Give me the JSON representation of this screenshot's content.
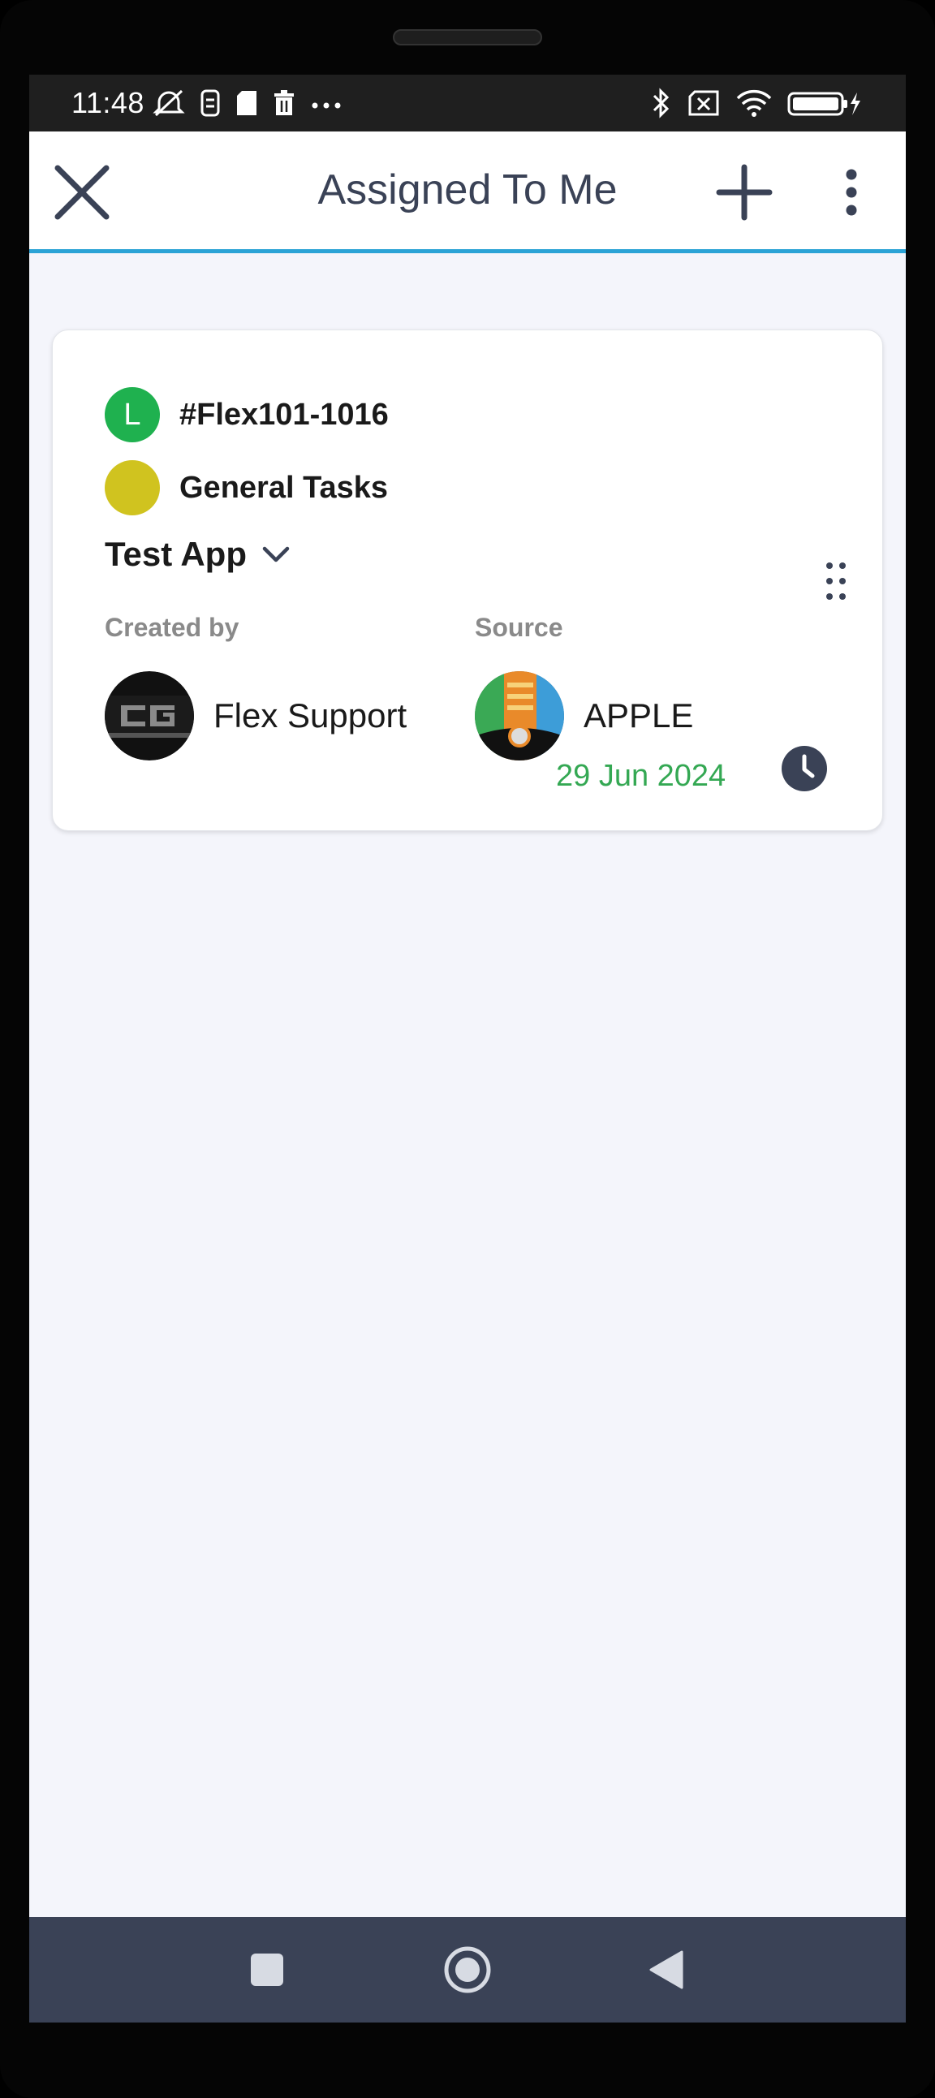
{
  "status_bar": {
    "time": "11:48",
    "left_icons": [
      "alarm-off-icon",
      "sim-icon",
      "sd-card-icon",
      "trash-icon",
      "more-dots-icon"
    ],
    "right_icons": [
      "bluetooth-icon",
      "no-sim-icon",
      "wifi-icon",
      "battery-charging-icon"
    ]
  },
  "header": {
    "title": "Assigned To Me",
    "close_icon": "close-icon",
    "add_icon": "plus-icon",
    "menu_icon": "more-vertical-icon"
  },
  "card": {
    "ticket_id": "#Flex101-1016",
    "ticket_badge_letter": "L",
    "ticket_badge_color": "#1fb14f",
    "category": "General Tasks",
    "category_color": "#d0c31f",
    "app_name": "Test App",
    "created_by_label": "Created by",
    "created_by_name": "Flex Support",
    "source_label": "Source",
    "source_name": "APPLE",
    "date": "29 Jun 2024",
    "date_color": "#34a853",
    "clock_icon_color": "#3a4256"
  },
  "nav_bar": {
    "recent_icon": "square-recent-icon",
    "home_icon": "circle-home-icon",
    "back_icon": "triangle-back-icon"
  }
}
